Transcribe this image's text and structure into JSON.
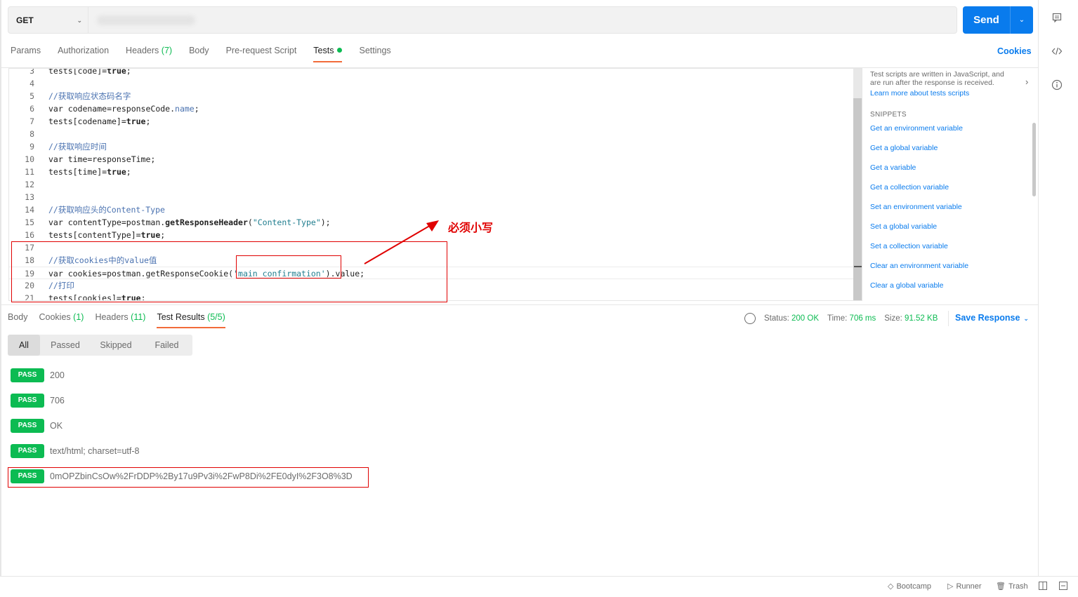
{
  "request": {
    "method": "GET",
    "send_label": "Send"
  },
  "request_tabs": [
    {
      "label": "Params"
    },
    {
      "label": "Authorization"
    },
    {
      "label": "Headers",
      "count": "(7)"
    },
    {
      "label": "Body"
    },
    {
      "label": "Pre-request Script"
    },
    {
      "label": "Tests"
    },
    {
      "label": "Settings"
    }
  ],
  "cookies_link": "Cookies",
  "editor": {
    "lines": [
      {
        "n": "3",
        "text": "tests[code]=true;"
      },
      {
        "n": "4",
        "text": ""
      },
      {
        "n": "5",
        "text": "//获取响应状态码名字"
      },
      {
        "n": "6",
        "text": "var codename=responseCode.name;"
      },
      {
        "n": "7",
        "text": "tests[codename]=true;"
      },
      {
        "n": "8",
        "text": ""
      },
      {
        "n": "9",
        "text": "//获取响应时间"
      },
      {
        "n": "10",
        "text": "var time=responseTime;"
      },
      {
        "n": "11",
        "text": "tests[time]=true;"
      },
      {
        "n": "12",
        "text": ""
      },
      {
        "n": "13",
        "text": ""
      },
      {
        "n": "14",
        "text": "//获取响应头的Content-Type"
      },
      {
        "n": "15",
        "text": "var contentType=postman.getResponseHeader(\"Content-Type\");"
      },
      {
        "n": "16",
        "text": "tests[contentType]=true;"
      },
      {
        "n": "17",
        "text": ""
      },
      {
        "n": "18",
        "text": "//获取cookies中的value值"
      },
      {
        "n": "19",
        "text": "var cookies=postman.getResponseCookie('main_confirmation').value;"
      },
      {
        "n": "20",
        "text": "//打印"
      },
      {
        "n": "21",
        "text": "tests[cookies]=true;"
      }
    ]
  },
  "snippets": {
    "description": "Test scripts are written in JavaScript, and are run after the response is received.",
    "learn_more": "Learn more about tests scripts",
    "heading": "SNIPPETS",
    "items": [
      "Get an environment variable",
      "Get a global variable",
      "Get a variable",
      "Get a collection variable",
      "Set an environment variable",
      "Set a global variable",
      "Set a collection variable",
      "Clear an environment variable",
      "Clear a global variable"
    ]
  },
  "annotation": "必须小写",
  "response_tabs": [
    {
      "label": "Body",
      "count": ""
    },
    {
      "label": "Cookies",
      "count": "(1)"
    },
    {
      "label": "Headers",
      "count": "(11)"
    },
    {
      "label": "Test Results",
      "count": "(5/5)"
    }
  ],
  "response_meta": {
    "status_label": "Status:",
    "status": "200 OK",
    "time_label": "Time:",
    "time": "706 ms",
    "size_label": "Size:",
    "size": "91.52 KB",
    "save_label": "Save Response"
  },
  "filters": [
    "All",
    "Passed",
    "Skipped",
    "Failed"
  ],
  "results": [
    {
      "badge": "PASS",
      "name": "200"
    },
    {
      "badge": "PASS",
      "name": "706"
    },
    {
      "badge": "PASS",
      "name": "OK"
    },
    {
      "badge": "PASS",
      "name": "text/html; charset=utf-8"
    },
    {
      "badge": "PASS",
      "name": "0mOPZbinCsOw%2FrDDP%2By17u9Pv3i%2FwP8Di%2FE0dyI%2F3O8%3D"
    }
  ],
  "footer": {
    "bootcamp": "Bootcamp",
    "runner": "Runner",
    "trash": "Trash"
  },
  "colors": {
    "accent": "#097bed",
    "pass": "#0cbb52",
    "active_tab_underline": "#f26b3a",
    "annotation_red": "#e00000"
  }
}
